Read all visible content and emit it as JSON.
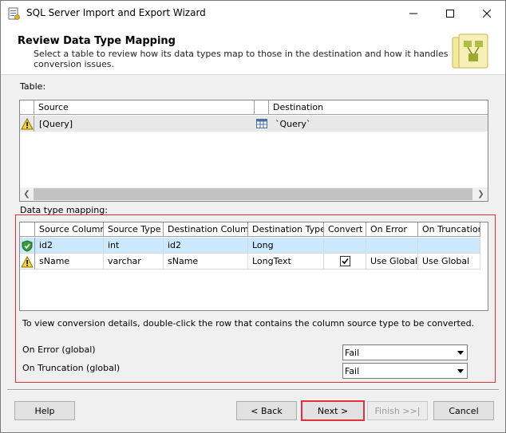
{
  "window": {
    "title": "SQL Server Import and Export Wizard"
  },
  "header": {
    "title": "Review Data Type Mapping",
    "description": "Select a table to review how its data types map to those in the destination and how it handles conversion issues."
  },
  "table_section": {
    "label": "Table:",
    "columns": [
      "Source",
      "Destination"
    ],
    "rows": [
      {
        "status": "warning",
        "source": "[Query]",
        "destination": "`Query`"
      }
    ]
  },
  "mapping_section": {
    "label": "Data type mapping:",
    "columns": [
      "Source Column",
      "Source Type",
      "Destination Column",
      "Destination Type",
      "Convert",
      "On Error",
      "On Truncation"
    ],
    "rows": [
      {
        "status": "ok",
        "source_column": "id2",
        "source_type": "int",
        "destination_column": "id2",
        "destination_type": "Long",
        "convert": false,
        "on_error": "",
        "on_truncation": ""
      },
      {
        "status": "warning",
        "source_column": "sName",
        "source_type": "varchar",
        "destination_column": "sName",
        "destination_type": "LongText",
        "convert": true,
        "on_error": "Use Global",
        "on_truncation": "Use Global"
      }
    ],
    "hint": "To view conversion details, double-click the row that contains the column source type to be converted."
  },
  "global": {
    "on_error_label": "On Error (global)",
    "on_error_value": "Fail",
    "on_truncation_label": "On Truncation (global)",
    "on_truncation_value": "Fail"
  },
  "buttons": {
    "help": "Help",
    "back": "< Back",
    "next": "Next >",
    "finish": "Finish >>|",
    "cancel": "Cancel"
  },
  "colors": {
    "selection": "#cce8ff",
    "highlight_border": "#e0303b"
  }
}
